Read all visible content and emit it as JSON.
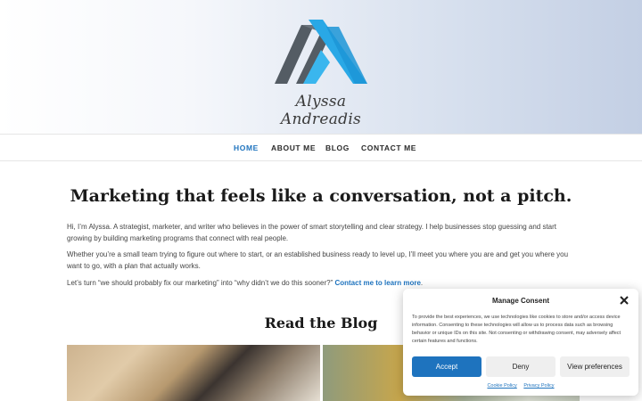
{
  "brand": {
    "signature": "Alyssa Andreadis",
    "colors": {
      "logo_blue": "#29a8e6",
      "logo_gray": "#545c64",
      "accent": "#1e73be"
    }
  },
  "nav": {
    "items": [
      {
        "label": "HOME",
        "active": true
      },
      {
        "label": "ABOUT ME"
      },
      {
        "label": "BLOG"
      },
      {
        "label": "CONTACT ME"
      }
    ]
  },
  "main": {
    "headline": "Marketing that feels like a conversation, not a pitch.",
    "p1": "Hi, I’m Alyssa. A strategist, marketer, and writer who believes in the power of smart storytelling and clear strategy. I help businesses stop guessing and start growing by building marketing programs that connect with real people.",
    "p2": "Whether you’re a small team trying to figure out where to start, or an established business ready to level up, I’ll meet you where you are and get you where you want to go, with a plan that actually works.",
    "p3_text": "Let’s turn “we should probably fix our marketing” into “why didn’t we do this sooner?” ",
    "p3_link": "Contact me to learn more",
    "p3_end": "."
  },
  "blog": {
    "title": "Read the Blog"
  },
  "consent": {
    "title": "Manage Consent",
    "body": "To provide the best experiences, we use technologies like cookies to store and/or access device information. Consenting to these technologies will allow us to process data such as browsing behavior or unique IDs on this site. Not consenting or withdrawing consent, may adversely affect certain features and functions.",
    "accept": "Accept",
    "deny": "Deny",
    "preferences": "View preferences",
    "cookie_policy": "Cookie Policy",
    "privacy_policy": "Privacy Policy"
  }
}
